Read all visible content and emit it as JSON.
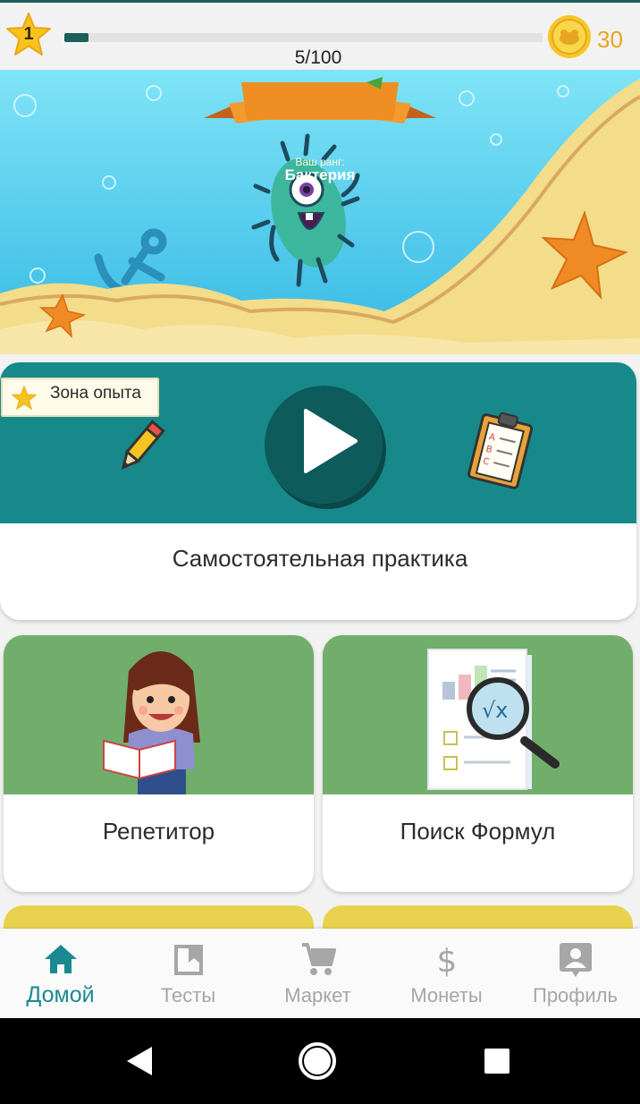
{
  "status": {
    "level": "1",
    "xp_text": "5/100",
    "xp_progress": 0.05,
    "coins": "30"
  },
  "hero": {
    "rank_label": "Ваш ранг:",
    "rank_name": "Бактерия"
  },
  "practice": {
    "badge": "Зона опыта",
    "title": "Самостоятельная практика"
  },
  "features": [
    {
      "title": "Репетитор"
    },
    {
      "title": "Поиск Формул"
    }
  ],
  "nav": {
    "items": [
      {
        "label": "Домой",
        "icon": "home-icon",
        "active": true
      },
      {
        "label": "Тесты",
        "icon": "bookmark-icon",
        "active": false
      },
      {
        "label": "Маркет",
        "icon": "cart-icon",
        "active": false
      },
      {
        "label": "Монеты",
        "icon": "dollar-icon",
        "active": false
      },
      {
        "label": "Профиль",
        "icon": "profile-icon",
        "active": false
      }
    ]
  },
  "colors": {
    "accent": "#1a8a90",
    "practice_bg": "#18898a",
    "feature_bg": "#72ae6b",
    "coin": "#e8a520"
  }
}
